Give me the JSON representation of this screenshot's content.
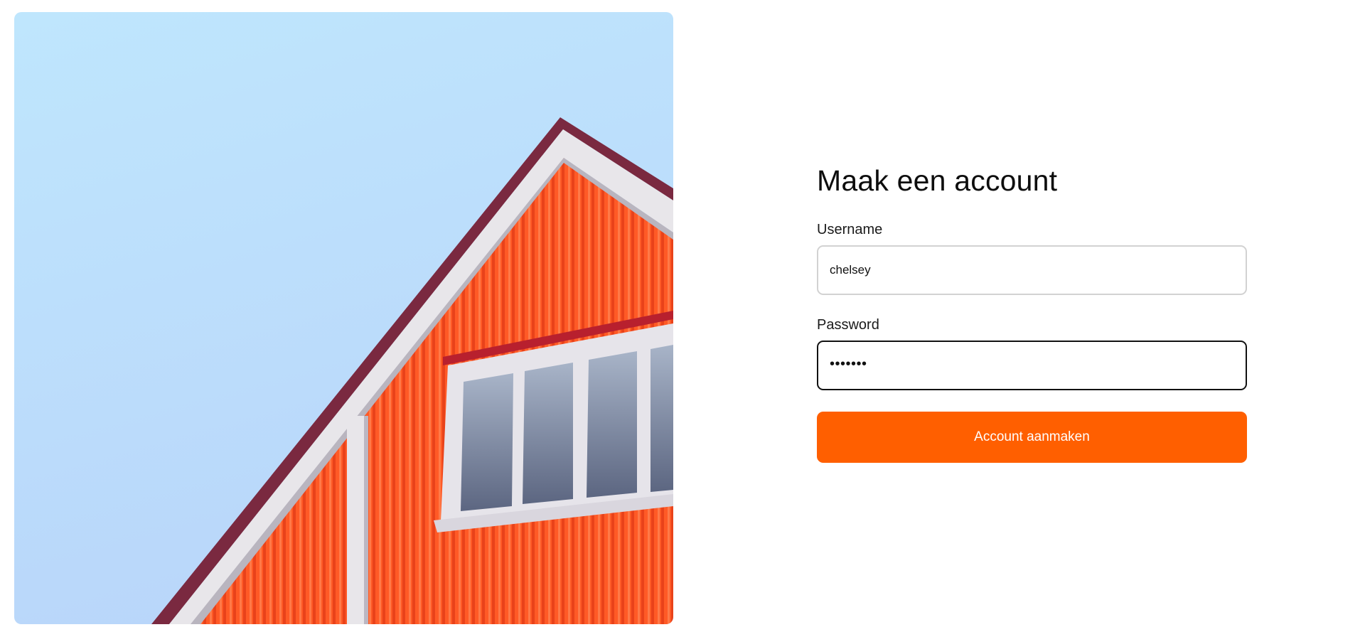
{
  "form": {
    "title": "Maak een account",
    "username": {
      "label": "Username",
      "value": "chelsey"
    },
    "password": {
      "label": "Password",
      "value": "•••••••"
    },
    "submit_label": "Account aanmaken"
  },
  "colors": {
    "accent": "#ff5f00",
    "sky": "#b6e2fc",
    "siding": "#ff5a26",
    "trim": "#e8e6ea",
    "focus_border": "#111111",
    "default_border": "#d2d2d2"
  },
  "image": {
    "subject": "orange-house-gable-photo"
  }
}
